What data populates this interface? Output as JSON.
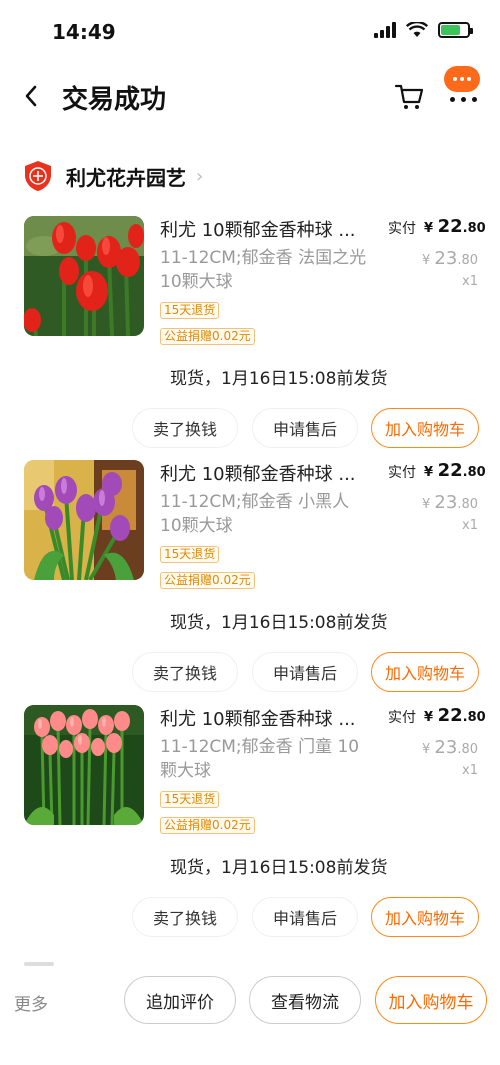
{
  "status": {
    "time": "14:49"
  },
  "nav": {
    "title": "交易成功"
  },
  "shop": {
    "name": "利尤花卉园艺",
    "logo_text": "企"
  },
  "labels": {
    "paid": "实付",
    "currency": "¥",
    "sell": "卖了换钱",
    "after_sale": "申请售后",
    "add_cart": "加入购物车",
    "tag_return": "15天退货",
    "tag_charity": "公益捐赠0.02元"
  },
  "items": [
    {
      "title": "利尤 10颗郁金香种球 ...",
      "spec": "11-12CM;郁金香 法国之光 10颗大球",
      "paid_int": "22",
      "paid_dec": ".80",
      "orig_int": "23",
      "orig_dec": ".80",
      "qty": "x1",
      "ship": "现货，1月16日15:08前发货",
      "image": "red-tulips"
    },
    {
      "title": "利尤 10颗郁金香种球 ...",
      "spec": "11-12CM;郁金香 小黑人 10颗大球",
      "paid_int": "22",
      "paid_dec": ".80",
      "orig_int": "23",
      "orig_dec": ".80",
      "qty": "x1",
      "ship": "现货，1月16日15:08前发货",
      "image": "purple-tulips"
    },
    {
      "title": "利尤 10颗郁金香种球 ...",
      "spec": "11-12CM;郁金香 门童 10颗大球",
      "paid_int": "22",
      "paid_dec": ".80",
      "orig_int": "23",
      "orig_dec": ".80",
      "qty": "x1",
      "ship": "现货，1月16日15:08前发货",
      "image": "pink-tulips"
    }
  ],
  "bottom": {
    "more": "更多",
    "review": "追加评价",
    "logistics": "查看物流",
    "add_cart": "加入购物车"
  },
  "colors": {
    "accent": "#ff6a00",
    "tag": "#e08a00",
    "shop_logo": "#e8321e"
  }
}
